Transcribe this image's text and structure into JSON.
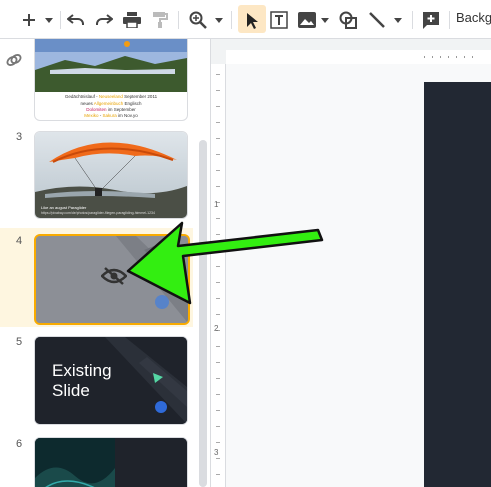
{
  "toolbar": {
    "background_label": "Backg",
    "icons": [
      "new-slide-plus-icon",
      "undo-icon",
      "redo-icon",
      "print-icon",
      "paint-format-icon",
      "zoom-icon",
      "select-cursor-icon",
      "textbox-icon",
      "image-icon",
      "shape-icon",
      "line-icon",
      "comment-add-icon"
    ]
  },
  "filmstrip": {
    "slides": [
      {
        "number": "",
        "caption_line1": "Gedächtnislauf - ",
        "caption_accent1": "Neuseeland",
        "caption_rest1": " September 2011",
        "caption_line2": "neues ",
        "caption_accent2": "Allgemeinbuch",
        "caption_rest2": " Englisch",
        "caption_line3": "Dolomiten",
        "caption_rest3": " im September",
        "caption_line4": "Mexiko",
        "caption_rest4": " - ",
        "caption_accent4": "Sakura",
        "caption_rest4b": " im Nov.yo"
      },
      {
        "number": "3",
        "caption": "Like an august Paraglider",
        "url_text": "https://pixabay.com/de/photos/paraglider-fliegen-paragliding-himmel-1234"
      },
      {
        "number": "4",
        "state": "hidden",
        "selected": true
      },
      {
        "number": "5",
        "title_line1": "Existing",
        "title_line2": "Slide"
      },
      {
        "number": "6"
      }
    ]
  },
  "ruler": {
    "h_marks": [],
    "v_marks": [
      "1",
      "2",
      "3"
    ]
  },
  "colors": {
    "accent_orange": "#f9ab00",
    "arrow_green": "#33ee11",
    "dark_slide": "#222833"
  }
}
